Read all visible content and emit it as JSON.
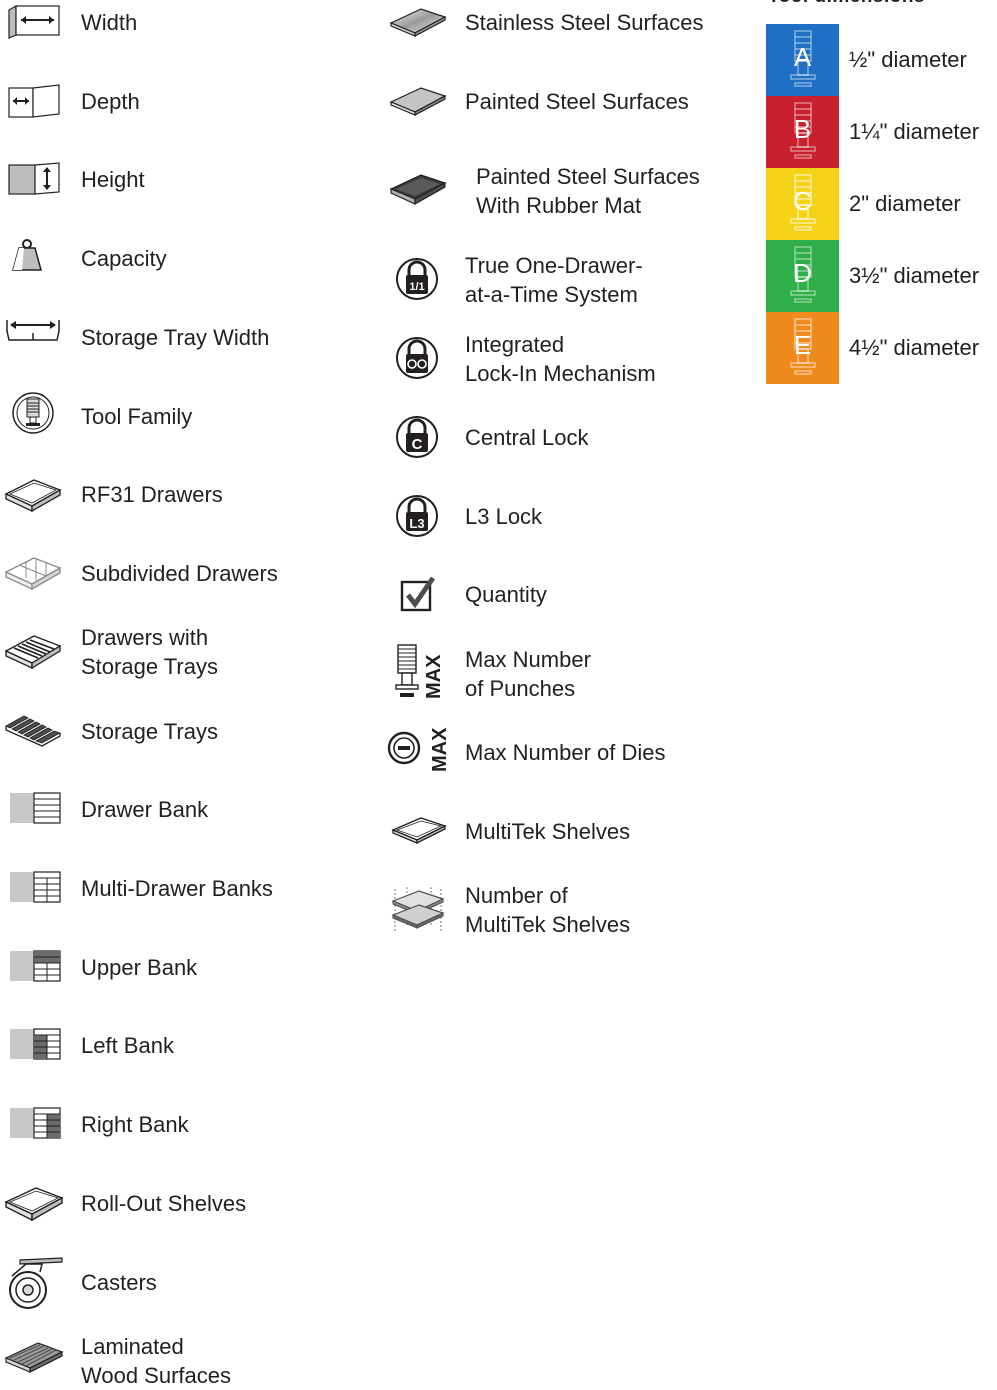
{
  "colors": {
    "icon_stroke": "#231f20",
    "icon_fill_light": "#d9d9d9",
    "icon_fill_dark": "#4d4d4d",
    "tool_a": "#1f6fc5",
    "tool_b": "#c8202e",
    "tool_c": "#f4d316",
    "tool_d": "#2fae4a",
    "tool_e": "#f08a1c"
  },
  "col1": [
    {
      "icon": "width-icon",
      "lines": [
        "Width"
      ]
    },
    {
      "icon": "depth-icon",
      "lines": [
        "Depth"
      ]
    },
    {
      "icon": "height-icon",
      "lines": [
        "Height"
      ]
    },
    {
      "icon": "capacity-weight-icon",
      "lines": [
        "Capacity"
      ]
    },
    {
      "icon": "storage-tray-width-icon",
      "lines": [
        "Storage Tray Width"
      ]
    },
    {
      "icon": "tool-family-icon",
      "lines": [
        "Tool Family"
      ]
    },
    {
      "icon": "rf31-drawer-icon",
      "lines": [
        "RF31 Drawers"
      ]
    },
    {
      "icon": "subdivided-drawer-icon",
      "lines": [
        "Subdivided Drawers"
      ]
    },
    {
      "icon": "drawer-with-trays-icon",
      "lines": [
        "Drawers with",
        "Storage Trays"
      ]
    },
    {
      "icon": "storage-trays-icon",
      "lines": [
        "Storage  Trays"
      ]
    },
    {
      "icon": "drawer-bank-icon",
      "lines": [
        "Drawer Bank"
      ]
    },
    {
      "icon": "multi-drawer-bank-icon",
      "lines": [
        "Multi-Drawer Banks"
      ]
    },
    {
      "icon": "upper-bank-icon",
      "lines": [
        "Upper Bank"
      ]
    },
    {
      "icon": "left-bank-icon",
      "lines": [
        "Left Bank"
      ]
    },
    {
      "icon": "right-bank-icon",
      "lines": [
        "Right Bank"
      ]
    },
    {
      "icon": "roll-out-shelf-icon",
      "lines": [
        "Roll-Out Shelves"
      ]
    },
    {
      "icon": "caster-icon",
      "lines": [
        "Casters"
      ]
    },
    {
      "icon": "laminated-wood-icon",
      "lines": [
        "Laminated",
        "Wood Surfaces"
      ]
    }
  ],
  "col2": [
    {
      "icon": "stainless-steel-icon",
      "lines": [
        "Stainless Steel Surfaces"
      ]
    },
    {
      "icon": "painted-steel-icon",
      "lines": [
        "Painted Steel Surfaces"
      ]
    },
    {
      "icon": "rubber-mat-icon",
      "lines": [
        "Painted Steel Surfaces",
        "With Rubber Mat"
      ]
    },
    {
      "icon": "one-drawer-lock-icon",
      "lines": [
        "True One-Drawer-",
        "at-a-Time System"
      ],
      "badge": "1/1"
    },
    {
      "icon": "lock-in-mechanism-icon",
      "lines": [
        "Integrated",
        "Lock-In Mechanism"
      ]
    },
    {
      "icon": "central-lock-icon",
      "lines": [
        "Central Lock"
      ],
      "badge": "C"
    },
    {
      "icon": "l3-lock-icon",
      "lines": [
        "L3 Lock"
      ],
      "badge": "L3"
    },
    {
      "icon": "quantity-checkbox-icon",
      "lines": [
        "Quantity"
      ]
    },
    {
      "icon": "max-punches-icon",
      "lines": [
        "Max Number",
        "of Punches"
      ],
      "badge": "MAX"
    },
    {
      "icon": "max-dies-icon",
      "lines": [
        "Max Number of Dies"
      ],
      "badge": "MAX"
    },
    {
      "icon": "multitek-shelf-icon",
      "lines": [
        "MultiTek Shelves"
      ]
    },
    {
      "icon": "multitek-shelf-count-icon",
      "lines": [
        "Number of",
        "MultiTek Shelves"
      ]
    }
  ],
  "tool_dimensions": {
    "title": "Tool dimensions",
    "items": [
      {
        "letter": "A",
        "text": "½\" diameter",
        "color": "#1f6fc5"
      },
      {
        "letter": "B",
        "text": "1¼\" diameter",
        "color": "#c8202e"
      },
      {
        "letter": "C",
        "text": "2\" diameter",
        "color": "#f4d316"
      },
      {
        "letter": "D",
        "text": "3½\" diameter",
        "color": "#2fae4a"
      },
      {
        "letter": "E",
        "text": "4½\" diameter",
        "color": "#f08a1c"
      }
    ]
  }
}
